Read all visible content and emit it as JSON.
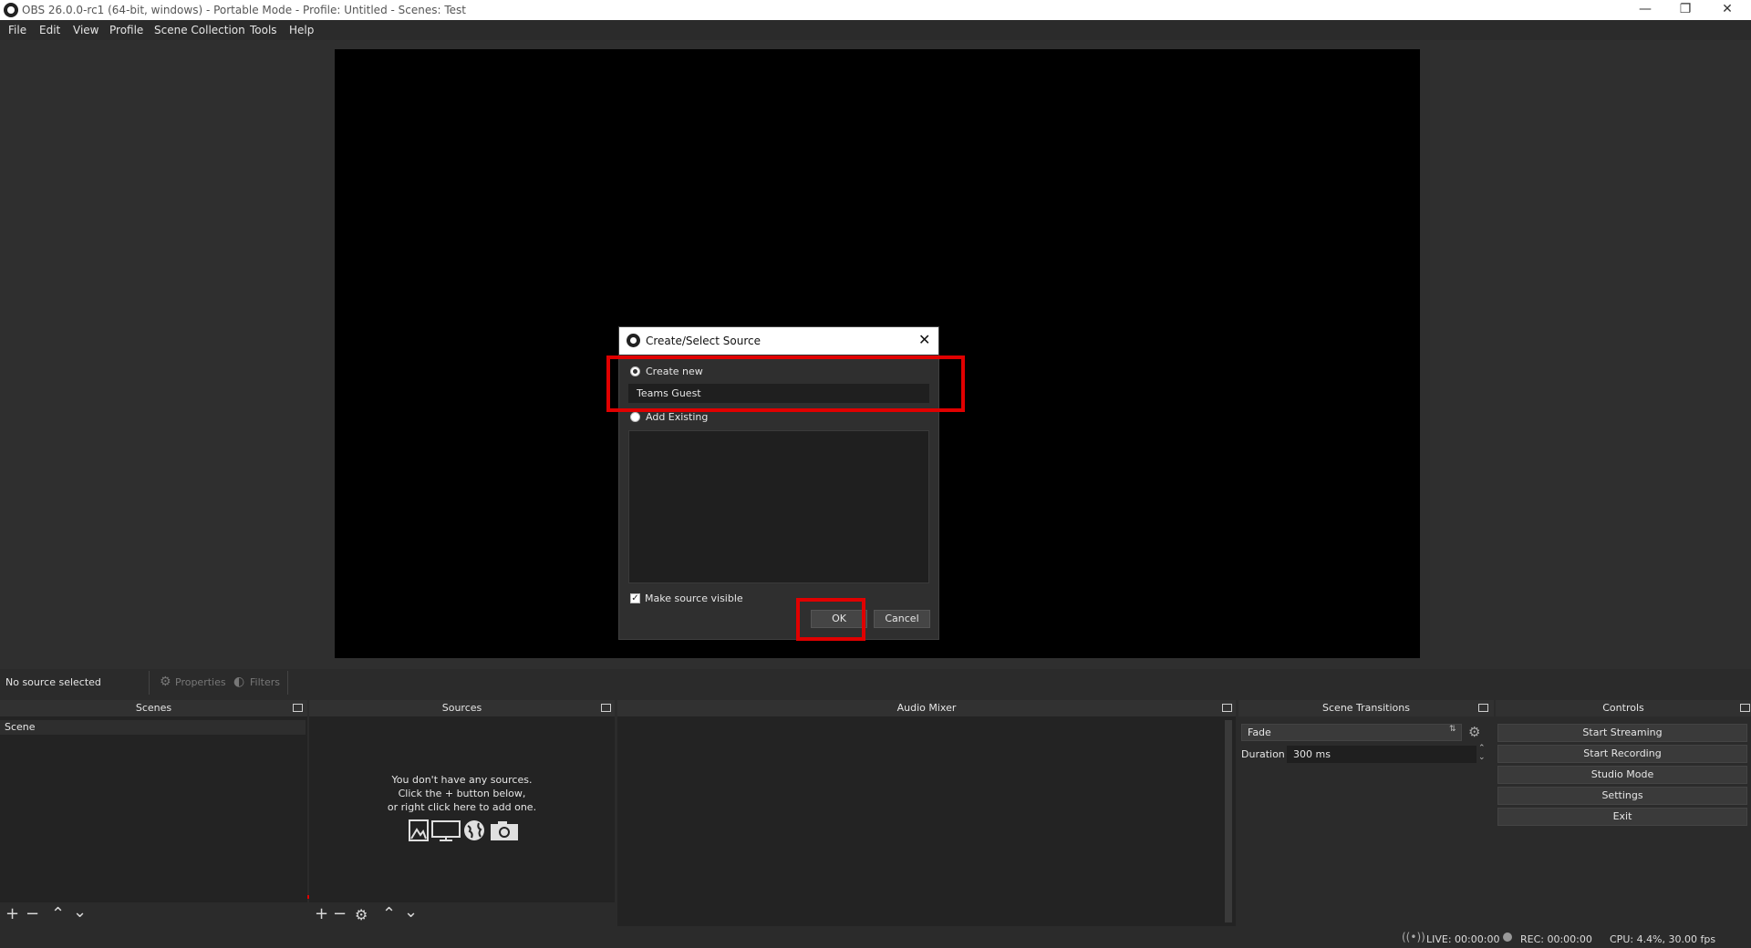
{
  "window": {
    "title": "OBS 26.0.0-rc1 (64-bit, windows) - Portable Mode - Profile: Untitled - Scenes: Test",
    "minimize": "—",
    "restore": "❐",
    "close": "✕"
  },
  "menu": [
    "File",
    "Edit",
    "View",
    "Profile",
    "Scene Collection",
    "Tools",
    "Help"
  ],
  "dialog": {
    "title": "Create/Select Source",
    "create_new_label": "Create new",
    "name_value": "Teams Guest",
    "add_existing_label": "Add Existing",
    "make_visible_label": "Make source visible",
    "ok_label": "OK",
    "cancel_label": "Cancel"
  },
  "source_toolbar": {
    "status": "No source selected",
    "properties_label": "Properties",
    "filters_label": "Filters"
  },
  "docks": {
    "scenes": {
      "header": "Scenes",
      "items": [
        "Scene"
      ]
    },
    "sources": {
      "header": "Sources",
      "empty_line1": "You don't have any sources.",
      "empty_line2": "Click the + button below,",
      "empty_line3": "or right click here to add one."
    },
    "audio_mixer": {
      "header": "Audio Mixer"
    },
    "transitions": {
      "header": "Scene Transitions",
      "selected": "Fade",
      "duration_label": "Duration",
      "duration_value": "300 ms"
    },
    "controls": {
      "header": "Controls",
      "buttons": [
        "Start Streaming",
        "Start Recording",
        "Studio Mode",
        "Settings",
        "Exit"
      ]
    }
  },
  "statusbar": {
    "live": "LIVE: 00:00:00",
    "rec": "REC: 00:00:00",
    "cpu": "CPU: 4.4%, 30.00 fps"
  },
  "colors": {
    "highlight": "#e00000",
    "panel_bg": "#232323",
    "app_bg": "#2b2b2b"
  }
}
